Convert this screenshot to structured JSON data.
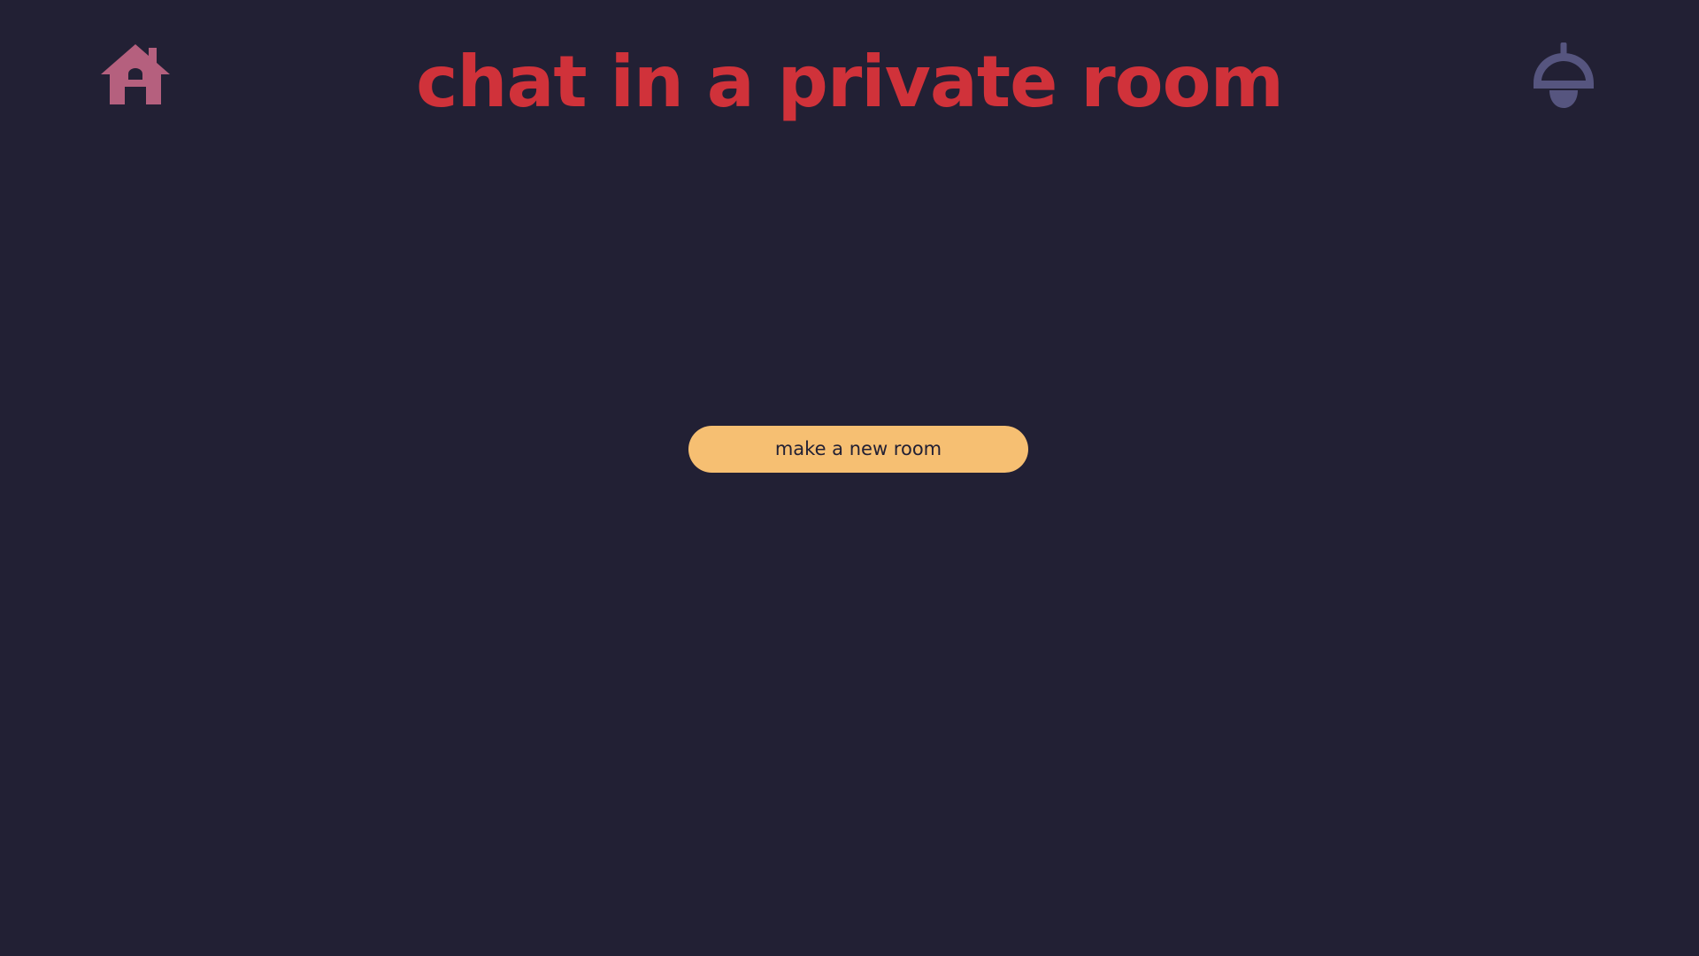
{
  "header": {
    "title": "chat in a private room",
    "home_icon": "home-icon",
    "lamp_icon": "ceiling-lamp-icon"
  },
  "main": {
    "new_room_button_label": "make a new room"
  },
  "colors": {
    "background": "#222034",
    "title": "#d0323a",
    "home_icon": "#b5607e",
    "lamp_icon": "#56557f",
    "button_background": "#f6bf72",
    "button_text": "#222034"
  }
}
